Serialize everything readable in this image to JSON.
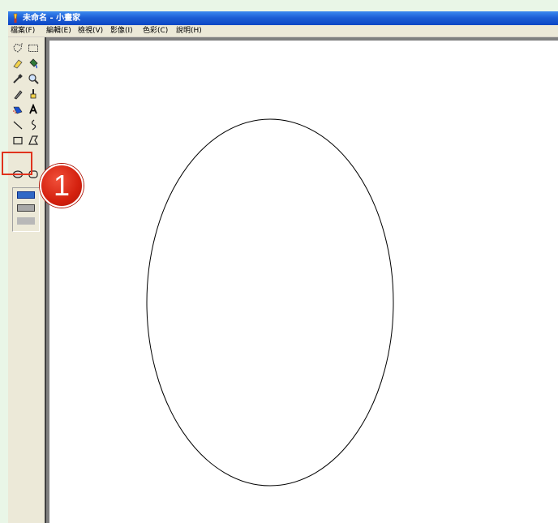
{
  "window": {
    "title": "未命名 - 小畫家",
    "icon": "paint-app-icon"
  },
  "menu": [
    {
      "label": "檔案(F)"
    },
    {
      "label": "編輯(E)"
    },
    {
      "label": "檢視(V)"
    },
    {
      "label": "影像(I)"
    },
    {
      "label": "色彩(C)"
    },
    {
      "label": "說明(H)"
    }
  ],
  "toolbox": {
    "tools": [
      "free-form-select-icon",
      "rect-select-icon",
      "eraser-icon",
      "fill-bucket-icon",
      "color-picker-icon",
      "magnifier-icon",
      "pencil-icon",
      "brush-icon",
      "airbrush-icon",
      "text-icon",
      "line-icon",
      "curve-icon",
      "rectangle-icon",
      "polygon-icon",
      "ellipse-icon",
      "rounded-rect-icon"
    ],
    "selected_tool": "ellipse-icon",
    "fill_options": [
      "outline",
      "outline-with-fill",
      "fill-only"
    ],
    "selected_fill_option": "outline"
  },
  "annotation": {
    "step_number": "1",
    "highlight_color": "#e0331d",
    "badge_color": "#d4200e"
  },
  "colors": {
    "titlebar": "#1d5fd6",
    "chrome": "#ece9d8",
    "canvas": "#ffffff"
  }
}
